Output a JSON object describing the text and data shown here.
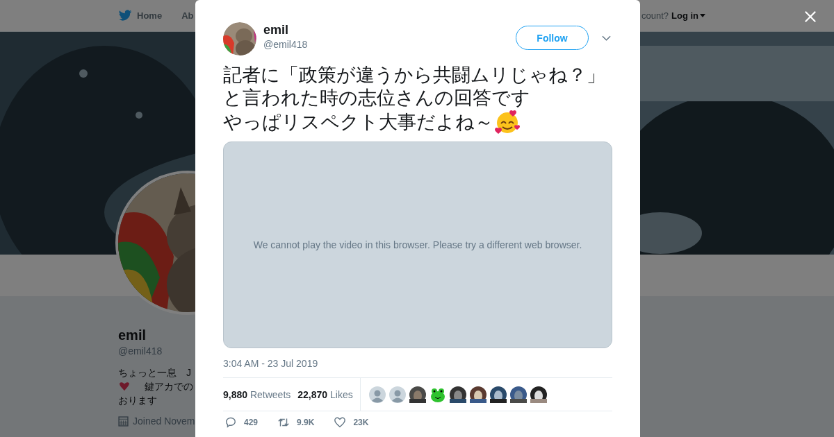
{
  "background_page": {
    "nav": [
      {
        "label": "Home"
      },
      {
        "label": "Ab"
      }
    ],
    "account_prompt": "count?",
    "login": "Log in",
    "profile": {
      "name": "emil",
      "handle": "@emil418",
      "bio_lines": [
        {
          "kind": "text",
          "text": "ちょっと一息　J"
        },
        {
          "kind": "heart",
          "text": "鍵アカでの"
        },
        {
          "kind": "text",
          "text": "おります"
        }
      ],
      "joined": "Joined Novem"
    }
  },
  "tweet": {
    "name": "emil",
    "handle": "@emil418",
    "follow_button": "Follow",
    "text_lines": [
      "記者に「政策が違うから共闘ムリじゃね？」",
      "と言われた時の志位さんの回答です",
      "やっぱリスペクト大事だよね～"
    ],
    "video_message": "We cannot play the video in this browser. Please try a different web browser.",
    "timestamp": "3:04 AM - 23 Jul 2019",
    "retweets": {
      "count": "9,880",
      "label": "Retweets"
    },
    "likes": {
      "count": "22,870",
      "label": "Likes"
    },
    "liker_avatars": [
      {
        "kind": "default"
      },
      {
        "kind": "default"
      },
      {
        "kind": "picture"
      },
      {
        "kind": "frog"
      },
      {
        "kind": "picture"
      },
      {
        "kind": "picture"
      },
      {
        "kind": "picture"
      },
      {
        "kind": "picture"
      },
      {
        "kind": "picture"
      }
    ],
    "actions": [
      {
        "kind": "reply",
        "count": "429"
      },
      {
        "kind": "retweet",
        "count": "9.9K"
      },
      {
        "kind": "like",
        "count": "23K"
      }
    ]
  }
}
